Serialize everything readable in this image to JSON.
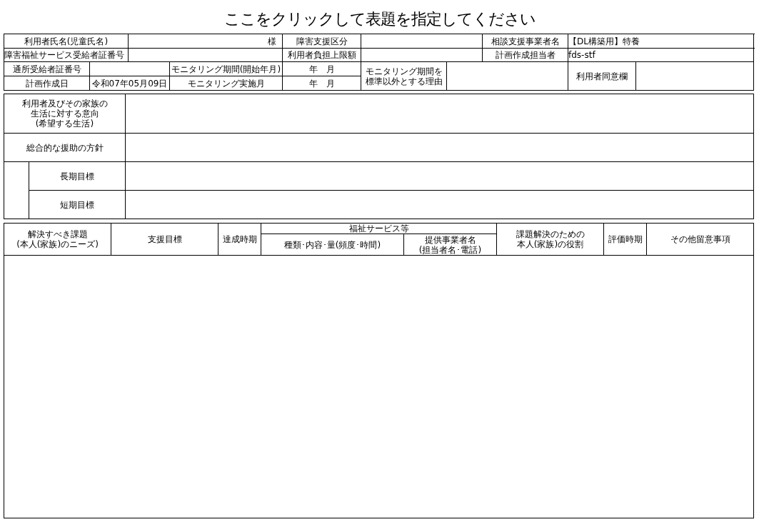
{
  "title": "ここをクリックして表題を指定してください",
  "info": {
    "user_name_label": "利用者氏名(児童氏名)",
    "user_name_suffix": "様",
    "support_level_label": "障害支援区分",
    "office_label": "相談支援事業者名",
    "office_value": "【DL構築用】特養",
    "certificate_label": "障害福祉サービス受給者証番号",
    "burden_limit_label": "利用者負担上限額",
    "planner_label": "計画作成担当者",
    "planner_value": "fds-stf",
    "day_certificate_label": "通所受給者証番号",
    "monitoring_start_label": "モニタリング期間(開始年月)",
    "monitoring_start_value": "年　月",
    "reason_label": [
      "モニタリング期間を",
      "標準以外とする理由"
    ],
    "consent_label": "利用者同意欄",
    "plan_date_label": "計画作成日",
    "plan_date_value": "令和07年05月09日",
    "monitoring_month_label": "モニタリング実施月",
    "monitoring_month_value": "年　月"
  },
  "policy": {
    "wishes_label": [
      "利用者及びその家族の",
      "生活に対する意向",
      "(希望する生活)"
    ],
    "policy_label": "総合的な援助の方針",
    "long_term_label": "長期目標",
    "short_term_label": "短期目標"
  },
  "plan_table": {
    "columns": [
      [
        "解決すべき課題",
        "(本人(家族)のニーズ)"
      ],
      "支援目標",
      "達成時期",
      "福祉サービス等",
      [
        "課題解決のための",
        "本人(家族)の役割"
      ],
      "評価時期",
      "その他留意事項"
    ],
    "subcolumns": [
      "種類･内容･量(頻度･時間)",
      [
        "提供事業者名",
        "(担当者名･電話)"
      ]
    ]
  }
}
